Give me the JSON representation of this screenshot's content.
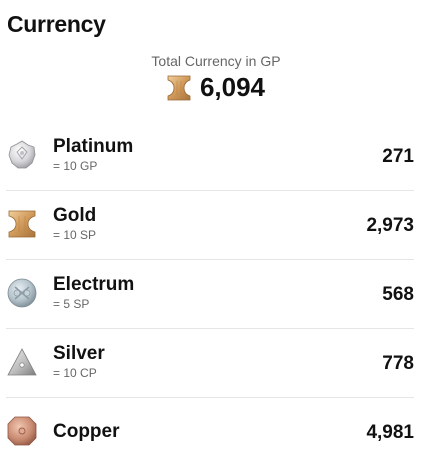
{
  "header": {
    "title": "Currency"
  },
  "total": {
    "label": "Total Currency in GP",
    "value": "6,094",
    "icon": "gold-coin-icon"
  },
  "currencies": [
    {
      "name": "Platinum",
      "rate": "= 10 GP",
      "amount": "271",
      "icon": "platinum-coin-icon",
      "color": "#d9d9dc"
    },
    {
      "name": "Gold",
      "rate": "= 10 SP",
      "amount": "2,973",
      "icon": "gold-coin-icon",
      "color": "#d4a56a"
    },
    {
      "name": "Electrum",
      "rate": "= 5 SP",
      "amount": "568",
      "icon": "electrum-coin-icon",
      "color": "#b7c4cc"
    },
    {
      "name": "Silver",
      "rate": "= 10 CP",
      "amount": "778",
      "icon": "silver-coin-icon",
      "color": "#bdbdbd"
    },
    {
      "name": "Copper",
      "rate": "",
      "amount": "4,981",
      "icon": "copper-coin-icon",
      "color": "#c98b72"
    }
  ]
}
